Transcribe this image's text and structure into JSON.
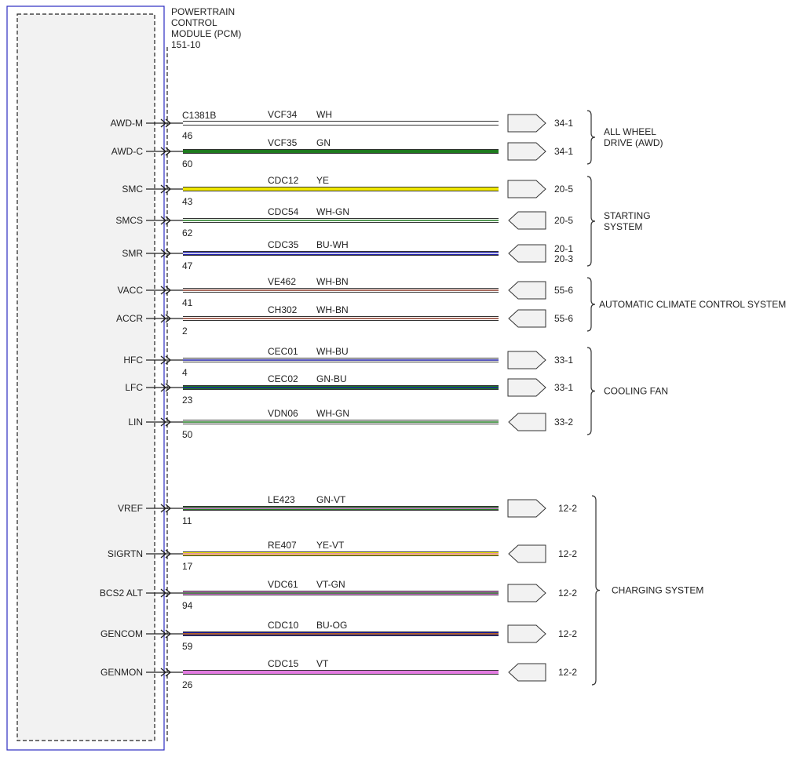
{
  "module": {
    "title_lines": [
      "POWERTRAIN",
      "CONTROL",
      "MODULE (PCM)",
      "151-10"
    ],
    "connector": "C1381B"
  },
  "wire_colors": {
    "WH": "#ffffff",
    "GN": "#1e7a1e",
    "YE": "#f0e800",
    "BU": "#1a1aa6",
    "BN": "#8b3a2a",
    "VT": "#e27be0",
    "OG": "#e07a00"
  },
  "circuits": [
    {
      "pin_name": "AWD-M",
      "pin": "46",
      "circuit": "VCF34",
      "color_label": "WH",
      "base": "WH",
      "stripe": null,
      "end": "arrow-right",
      "dest": [
        "34-1"
      ]
    },
    {
      "pin_name": "AWD-C",
      "pin": "60",
      "circuit": "VCF35",
      "color_label": "GN",
      "base": "GN",
      "stripe": null,
      "end": "arrow-right",
      "dest": [
        "34-1"
      ]
    },
    {
      "pin_name": "SMC",
      "pin": "43",
      "circuit": "CDC12",
      "color_label": "YE",
      "base": "YE",
      "stripe": null,
      "end": "arrow-right",
      "dest": [
        "20-5"
      ]
    },
    {
      "pin_name": "SMCS",
      "pin": "62",
      "circuit": "CDC54",
      "color_label": "WH-GN",
      "base": "WH",
      "stripe": "GN",
      "end": "arrow-left",
      "dest": [
        "20-5"
      ]
    },
    {
      "pin_name": "SMR",
      "pin": "47",
      "circuit": "CDC35",
      "color_label": "BU-WH",
      "base": "BU",
      "stripe": "WH",
      "end": "arrow-left",
      "dest": [
        "20-1",
        "20-3"
      ]
    },
    {
      "pin_name": "VACC",
      "pin": "41",
      "circuit": "VE462",
      "color_label": "WH-BN",
      "base": "WH",
      "stripe": "BN",
      "end": "arrow-left",
      "dest": [
        "55-6"
      ]
    },
    {
      "pin_name": "ACCR",
      "pin": "2",
      "circuit": "CH302",
      "color_label": "WH-BN",
      "base": "WH",
      "stripe": "BN",
      "end": "arrow-left",
      "dest": [
        "55-6"
      ]
    },
    {
      "pin_name": "HFC",
      "pin": "4",
      "circuit": "CEC01",
      "color_label": "WH-BU",
      "base": "WH",
      "stripe": "BU",
      "end": "arrow-right",
      "dest": [
        "33-1"
      ]
    },
    {
      "pin_name": "LFC",
      "pin": "23",
      "circuit": "CEC02",
      "color_label": "GN-BU",
      "base": "GN",
      "stripe": "BU",
      "end": "arrow-right",
      "dest": [
        "33-1"
      ]
    },
    {
      "pin_name": "LIN",
      "pin": "50",
      "circuit": "VDN06",
      "color_label": "WH-GN",
      "base": "WH",
      "stripe": "GN",
      "end": "arrow-left",
      "dest": [
        "33-2"
      ]
    },
    {
      "pin_name": "VREF",
      "pin": "11",
      "circuit": "LE423",
      "color_label": "GN-VT",
      "base": "GN",
      "stripe": "VT",
      "end": "arrow-right",
      "dest": [
        "12-2"
      ]
    },
    {
      "pin_name": "SIGRTN",
      "pin": "17",
      "circuit": "RE407",
      "color_label": "YE-VT",
      "base": "YE",
      "stripe": "VT",
      "end": "arrow-left",
      "dest": [
        "12-2"
      ]
    },
    {
      "pin_name": "BCS2 ALT",
      "pin": "94",
      "circuit": "VDC61",
      "color_label": "VT-GN",
      "base": "VT",
      "stripe": "GN",
      "end": "arrow-right",
      "dest": [
        "12-2"
      ]
    },
    {
      "pin_name": "GENCOM",
      "pin": "59",
      "circuit": "CDC10",
      "color_label": "BU-OG",
      "base": "BU",
      "stripe": "OG",
      "end": "arrow-right",
      "dest": [
        "12-2"
      ]
    },
    {
      "pin_name": "GENMON",
      "pin": "26",
      "circuit": "CDC15",
      "color_label": "VT",
      "base": "VT",
      "stripe": null,
      "end": "arrow-left",
      "dest": [
        "12-2"
      ]
    }
  ],
  "systems": [
    {
      "lines": [
        "ALL WHEEL",
        "DRIVE (AWD)"
      ],
      "first": 0,
      "last": 1
    },
    {
      "lines": [
        "STARTING",
        "SYSTEM"
      ],
      "first": 2,
      "last": 4
    },
    {
      "lines": [
        "AUTOMATIC CLIMATE CONTROL SYSTEM"
      ],
      "first": 5,
      "last": 6
    },
    {
      "lines": [
        "COOLING FAN"
      ],
      "first": 7,
      "last": 9
    },
    {
      "lines": [
        "CHARGING SYSTEM"
      ],
      "first": 10,
      "last": 14
    }
  ]
}
